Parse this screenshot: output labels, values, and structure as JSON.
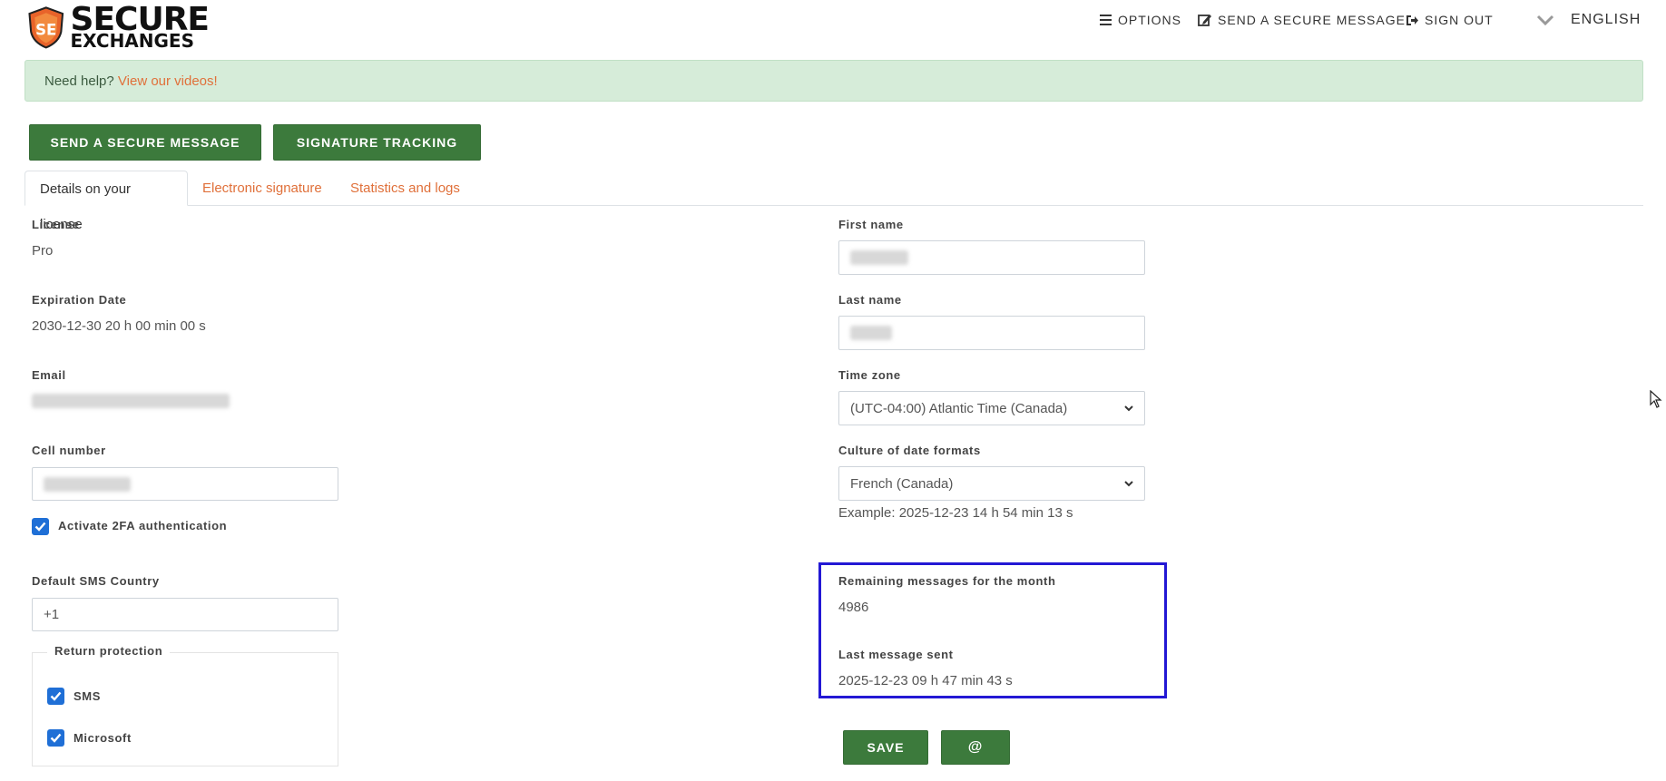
{
  "header": {
    "logo": {
      "line1": "SECURE",
      "line2": "EXCHANGES"
    },
    "nav": {
      "options": "OPTIONS",
      "send_secure": "SEND A SECURE MESSAGE",
      "sign_out": "SIGN OUT",
      "language": "ENGLISH"
    }
  },
  "help_banner": {
    "text": "Need help?",
    "link": "View our videos!"
  },
  "actions": {
    "send_secure_message": "SEND A SECURE MESSAGE",
    "signature_tracking": "SIGNATURE TRACKING"
  },
  "tabs": [
    {
      "label": "Details on your license",
      "active": true
    },
    {
      "label": "Electronic signature",
      "active": false
    },
    {
      "label": "Statistics and logs",
      "active": false
    }
  ],
  "left": {
    "license_label": "License",
    "license_value": "Pro",
    "expiration_label": "Expiration Date",
    "expiration_value": "2030-12-30 20 h 00 min 00 s",
    "email_label": "Email",
    "cell_label": "Cell number",
    "twofa_label": "Activate 2FA authentication",
    "sms_country_label": "Default SMS Country",
    "sms_country_value": "+1",
    "return_protection_label": "Return protection",
    "sms_label": "SMS",
    "microsoft_label": "Microsoft"
  },
  "right": {
    "first_name_label": "First name",
    "last_name_label": "Last name",
    "timezone_label": "Time zone",
    "timezone_value": "(UTC-04:00) Atlantic Time (Canada)",
    "culture_label": "Culture of date formats",
    "culture_value": "French (Canada)",
    "culture_example": "Example: 2025-12-23 14 h 54 min 13 s",
    "remaining_label": "Remaining messages for the month",
    "remaining_value": "4986",
    "last_sent_label": "Last message sent",
    "last_sent_value": "2025-12-23 09 h 47 min 43 s",
    "save": "SAVE",
    "at": "@"
  },
  "colors": {
    "primary_green": "#3c7a3c",
    "link_orange": "#e0703a",
    "help_bg": "#d6ecd9",
    "highlight_border": "#2318d4",
    "checkbox_blue": "#1f6fd6"
  }
}
